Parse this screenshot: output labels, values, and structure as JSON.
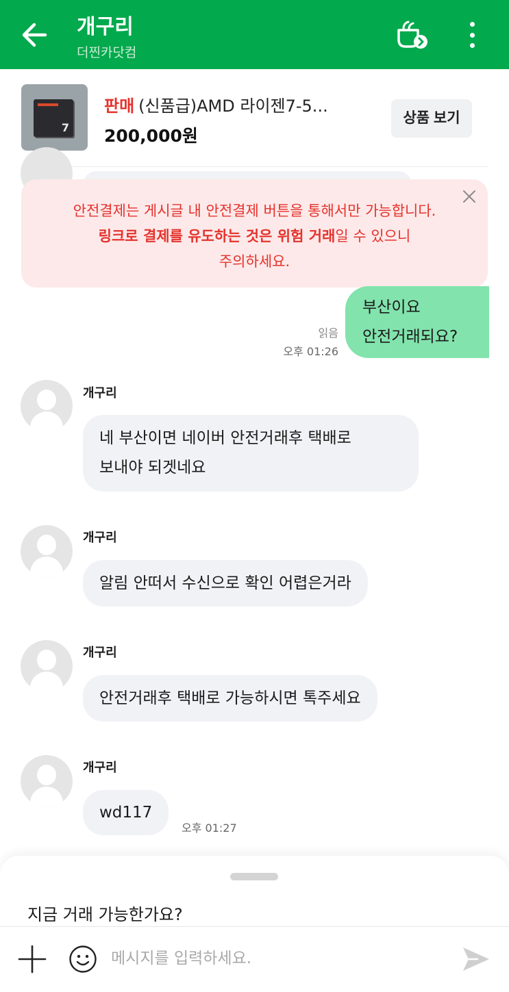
{
  "header": {
    "title": "개구리",
    "subtitle": "더찐카닷컴",
    "icons": [
      "back-arrow-icon",
      "cafe-chat-icon",
      "more-vertical-icon"
    ]
  },
  "product": {
    "status": "판매",
    "name": "(신품급)AMD 라이젠7-5...",
    "price": "200,000원",
    "view_button": "상품 보기"
  },
  "warning": {
    "line1": "안전결제는 게시글 내 안전결제 버튼을 통해서만 가능합니다.",
    "line2_strong": "링크로 결제를 유도하는 것은 위험 거래",
    "line2_rest": "일 수 있으니",
    "line3": "주의하세요.",
    "colors": {
      "text": "#e5322d",
      "background": "#fde9e9"
    }
  },
  "messages": {
    "mine": {
      "line1": "부산이요",
      "line2": "안전거래되요?",
      "read": "읽음",
      "time": "오후 01:26"
    },
    "theirs": [
      {
        "sender": "개구리",
        "line1": "네 부산이면 네이버 안전거래후 택배로",
        "line2": "보내야 되겟네요"
      },
      {
        "sender": "개구리",
        "text": "알림 안떠서 수신으로 확인 어렵은거라"
      },
      {
        "sender": "개구리",
        "text": "안전거래후 택배로 가능하시면 톡주세요"
      },
      {
        "sender": "개구리",
        "text": "wd117",
        "time": "오후 01:27"
      }
    ]
  },
  "composer": {
    "suggestion": "지금 거래 가능한가요?",
    "placeholder": "메시지를 입력하세요."
  },
  "colors": {
    "brand": "#03a94d",
    "my_bubble": "#82e3ad",
    "their_bubble": "#f1f2f5",
    "sale": "#e5322d"
  }
}
